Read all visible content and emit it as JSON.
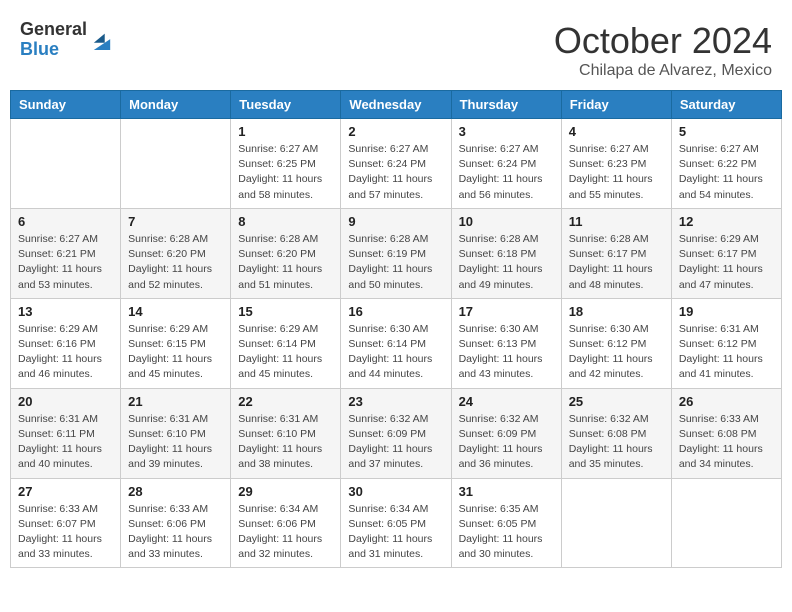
{
  "header": {
    "logo_general": "General",
    "logo_blue": "Blue",
    "month_title": "October 2024",
    "location": "Chilapa de Alvarez, Mexico"
  },
  "days_of_week": [
    "Sunday",
    "Monday",
    "Tuesday",
    "Wednesday",
    "Thursday",
    "Friday",
    "Saturday"
  ],
  "weeks": [
    [
      {
        "day": "",
        "sunrise": "",
        "sunset": "",
        "daylight": ""
      },
      {
        "day": "",
        "sunrise": "",
        "sunset": "",
        "daylight": ""
      },
      {
        "day": "1",
        "sunrise": "Sunrise: 6:27 AM",
        "sunset": "Sunset: 6:25 PM",
        "daylight": "Daylight: 11 hours and 58 minutes."
      },
      {
        "day": "2",
        "sunrise": "Sunrise: 6:27 AM",
        "sunset": "Sunset: 6:24 PM",
        "daylight": "Daylight: 11 hours and 57 minutes."
      },
      {
        "day": "3",
        "sunrise": "Sunrise: 6:27 AM",
        "sunset": "Sunset: 6:24 PM",
        "daylight": "Daylight: 11 hours and 56 minutes."
      },
      {
        "day": "4",
        "sunrise": "Sunrise: 6:27 AM",
        "sunset": "Sunset: 6:23 PM",
        "daylight": "Daylight: 11 hours and 55 minutes."
      },
      {
        "day": "5",
        "sunrise": "Sunrise: 6:27 AM",
        "sunset": "Sunset: 6:22 PM",
        "daylight": "Daylight: 11 hours and 54 minutes."
      }
    ],
    [
      {
        "day": "6",
        "sunrise": "Sunrise: 6:27 AM",
        "sunset": "Sunset: 6:21 PM",
        "daylight": "Daylight: 11 hours and 53 minutes."
      },
      {
        "day": "7",
        "sunrise": "Sunrise: 6:28 AM",
        "sunset": "Sunset: 6:20 PM",
        "daylight": "Daylight: 11 hours and 52 minutes."
      },
      {
        "day": "8",
        "sunrise": "Sunrise: 6:28 AM",
        "sunset": "Sunset: 6:20 PM",
        "daylight": "Daylight: 11 hours and 51 minutes."
      },
      {
        "day": "9",
        "sunrise": "Sunrise: 6:28 AM",
        "sunset": "Sunset: 6:19 PM",
        "daylight": "Daylight: 11 hours and 50 minutes."
      },
      {
        "day": "10",
        "sunrise": "Sunrise: 6:28 AM",
        "sunset": "Sunset: 6:18 PM",
        "daylight": "Daylight: 11 hours and 49 minutes."
      },
      {
        "day": "11",
        "sunrise": "Sunrise: 6:28 AM",
        "sunset": "Sunset: 6:17 PM",
        "daylight": "Daylight: 11 hours and 48 minutes."
      },
      {
        "day": "12",
        "sunrise": "Sunrise: 6:29 AM",
        "sunset": "Sunset: 6:17 PM",
        "daylight": "Daylight: 11 hours and 47 minutes."
      }
    ],
    [
      {
        "day": "13",
        "sunrise": "Sunrise: 6:29 AM",
        "sunset": "Sunset: 6:16 PM",
        "daylight": "Daylight: 11 hours and 46 minutes."
      },
      {
        "day": "14",
        "sunrise": "Sunrise: 6:29 AM",
        "sunset": "Sunset: 6:15 PM",
        "daylight": "Daylight: 11 hours and 45 minutes."
      },
      {
        "day": "15",
        "sunrise": "Sunrise: 6:29 AM",
        "sunset": "Sunset: 6:14 PM",
        "daylight": "Daylight: 11 hours and 45 minutes."
      },
      {
        "day": "16",
        "sunrise": "Sunrise: 6:30 AM",
        "sunset": "Sunset: 6:14 PM",
        "daylight": "Daylight: 11 hours and 44 minutes."
      },
      {
        "day": "17",
        "sunrise": "Sunrise: 6:30 AM",
        "sunset": "Sunset: 6:13 PM",
        "daylight": "Daylight: 11 hours and 43 minutes."
      },
      {
        "day": "18",
        "sunrise": "Sunrise: 6:30 AM",
        "sunset": "Sunset: 6:12 PM",
        "daylight": "Daylight: 11 hours and 42 minutes."
      },
      {
        "day": "19",
        "sunrise": "Sunrise: 6:31 AM",
        "sunset": "Sunset: 6:12 PM",
        "daylight": "Daylight: 11 hours and 41 minutes."
      }
    ],
    [
      {
        "day": "20",
        "sunrise": "Sunrise: 6:31 AM",
        "sunset": "Sunset: 6:11 PM",
        "daylight": "Daylight: 11 hours and 40 minutes."
      },
      {
        "day": "21",
        "sunrise": "Sunrise: 6:31 AM",
        "sunset": "Sunset: 6:10 PM",
        "daylight": "Daylight: 11 hours and 39 minutes."
      },
      {
        "day": "22",
        "sunrise": "Sunrise: 6:31 AM",
        "sunset": "Sunset: 6:10 PM",
        "daylight": "Daylight: 11 hours and 38 minutes."
      },
      {
        "day": "23",
        "sunrise": "Sunrise: 6:32 AM",
        "sunset": "Sunset: 6:09 PM",
        "daylight": "Daylight: 11 hours and 37 minutes."
      },
      {
        "day": "24",
        "sunrise": "Sunrise: 6:32 AM",
        "sunset": "Sunset: 6:09 PM",
        "daylight": "Daylight: 11 hours and 36 minutes."
      },
      {
        "day": "25",
        "sunrise": "Sunrise: 6:32 AM",
        "sunset": "Sunset: 6:08 PM",
        "daylight": "Daylight: 11 hours and 35 minutes."
      },
      {
        "day": "26",
        "sunrise": "Sunrise: 6:33 AM",
        "sunset": "Sunset: 6:08 PM",
        "daylight": "Daylight: 11 hours and 34 minutes."
      }
    ],
    [
      {
        "day": "27",
        "sunrise": "Sunrise: 6:33 AM",
        "sunset": "Sunset: 6:07 PM",
        "daylight": "Daylight: 11 hours and 33 minutes."
      },
      {
        "day": "28",
        "sunrise": "Sunrise: 6:33 AM",
        "sunset": "Sunset: 6:06 PM",
        "daylight": "Daylight: 11 hours and 33 minutes."
      },
      {
        "day": "29",
        "sunrise": "Sunrise: 6:34 AM",
        "sunset": "Sunset: 6:06 PM",
        "daylight": "Daylight: 11 hours and 32 minutes."
      },
      {
        "day": "30",
        "sunrise": "Sunrise: 6:34 AM",
        "sunset": "Sunset: 6:05 PM",
        "daylight": "Daylight: 11 hours and 31 minutes."
      },
      {
        "day": "31",
        "sunrise": "Sunrise: 6:35 AM",
        "sunset": "Sunset: 6:05 PM",
        "daylight": "Daylight: 11 hours and 30 minutes."
      },
      {
        "day": "",
        "sunrise": "",
        "sunset": "",
        "daylight": ""
      },
      {
        "day": "",
        "sunrise": "",
        "sunset": "",
        "daylight": ""
      }
    ]
  ]
}
